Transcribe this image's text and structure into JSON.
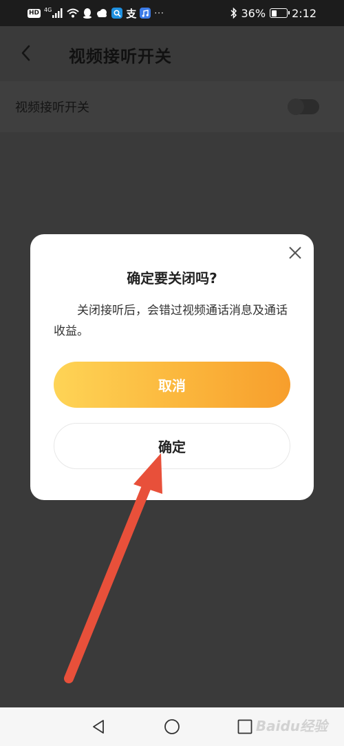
{
  "status_bar": {
    "hd_badge": "HD",
    "network_label": "4G",
    "alipay_glyph": "支",
    "more_dots": "···",
    "battery_percent": "36%",
    "battery_level": 0.36,
    "time": "2:12"
  },
  "header": {
    "title": "视频接听开关"
  },
  "setting": {
    "label": "视频接听开关",
    "enabled": false
  },
  "dialog": {
    "title": "确定要关闭吗?",
    "message": "关闭接听后，会错过视频通话消息及通话收益。",
    "cancel_label": "取消",
    "confirm_label": "确定"
  },
  "annotation": {
    "arrow_color": "#e8503a"
  },
  "colors": {
    "primary_gradient_start": "#fed456",
    "primary_gradient_end": "#f79e2c",
    "overlay_background": "#3a3a3a"
  },
  "nav_bar": {
    "watermark": "Baidu经验"
  }
}
